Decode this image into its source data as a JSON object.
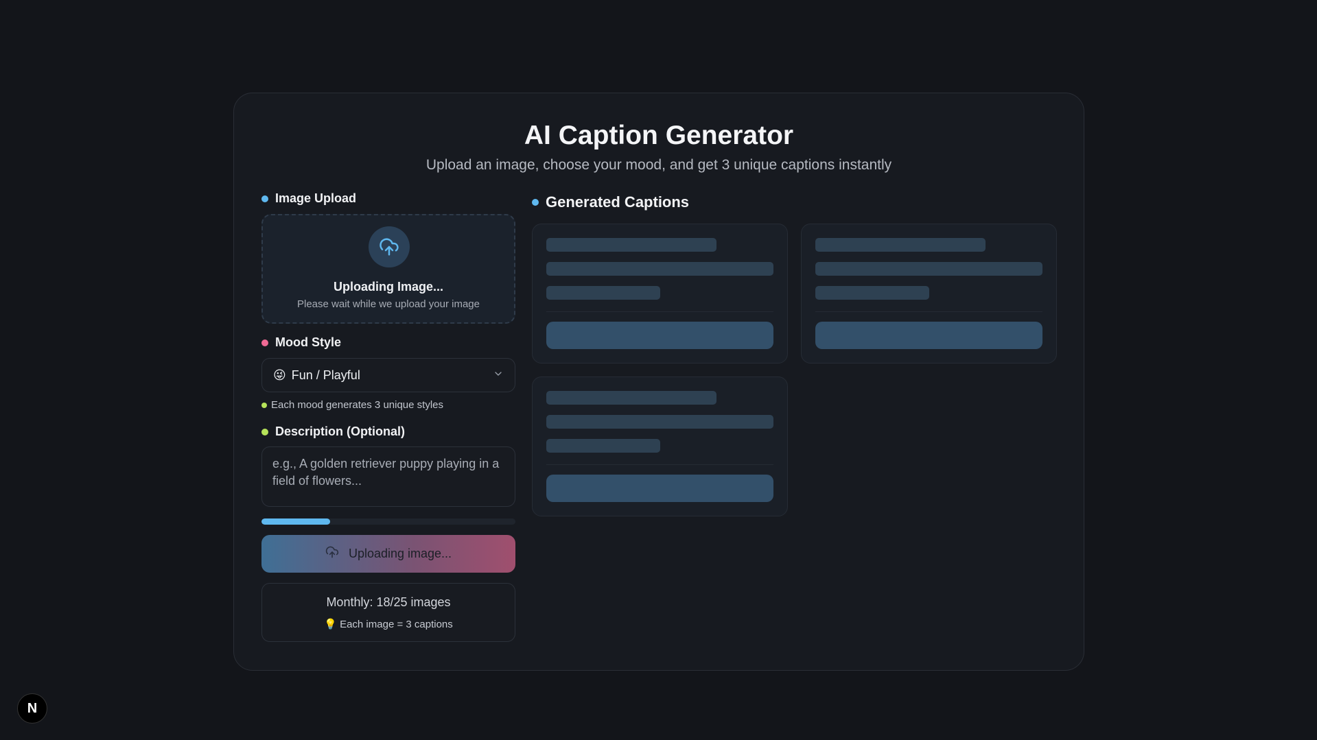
{
  "header": {
    "title": "AI Caption Generator",
    "subtitle": "Upload an image, choose your mood, and get 3 unique captions instantly"
  },
  "upload": {
    "section_label": "Image Upload",
    "section_dot_color": "#5fb8ef",
    "status_title": "Uploading Image...",
    "status_subtitle": "Please wait while we upload your image",
    "icon": "cloud-upload-icon"
  },
  "mood": {
    "section_label": "Mood Style",
    "section_dot_color": "#f06a95",
    "selected_emoji": "😜",
    "selected_value": "Fun / Playful",
    "hint": "Each mood generates 3 unique styles",
    "hint_dot_color": "#b6e35a"
  },
  "description": {
    "section_label": "Description (Optional)",
    "section_dot_color": "#b6e35a",
    "placeholder": "e.g., A golden retriever puppy playing in a field of flowers..."
  },
  "progress": {
    "fraction": 0.27,
    "color": "#5fb8ef"
  },
  "action": {
    "button_label": "Uploading image...",
    "icon": "cloud-upload-icon"
  },
  "usage": {
    "monthly": "Monthly: 18/25 images",
    "tip_emoji": "💡",
    "tip": "Each image = 3 captions"
  },
  "captions": {
    "section_label": "Generated Captions",
    "section_dot_color": "#5fb8ef",
    "placeholder_cards": 3
  },
  "badge": {
    "letter": "N"
  }
}
